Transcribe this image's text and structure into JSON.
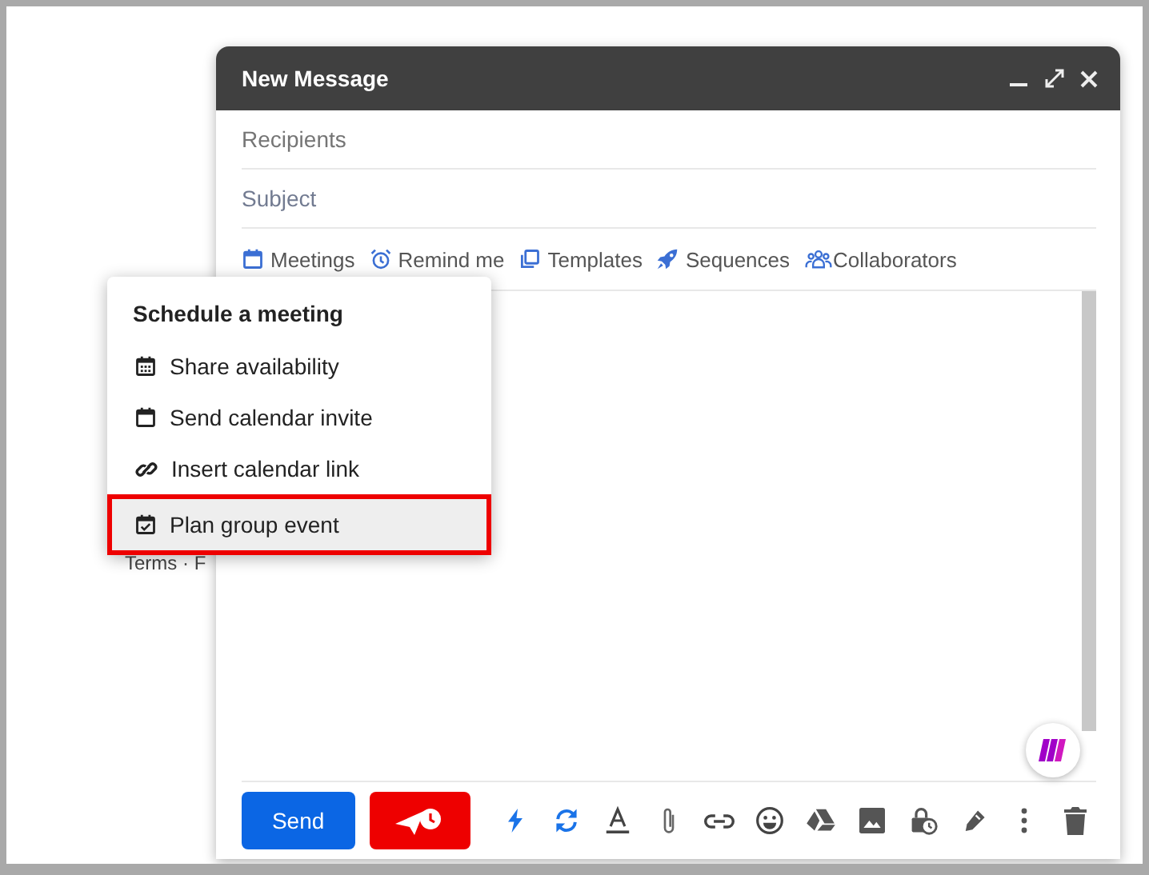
{
  "background": {
    "footer_text": "Terms · F"
  },
  "compose": {
    "title": "New Message",
    "fields": [
      {
        "kind": "recipients",
        "placeholder": "Recipients"
      },
      {
        "kind": "subject",
        "placeholder": "Subject"
      }
    ],
    "toolbar": [
      {
        "kind": "calendar",
        "label": "Meetings"
      },
      {
        "kind": "alarm",
        "label": "Remind me"
      },
      {
        "kind": "copy",
        "label": "Templates"
      },
      {
        "kind": "rocket",
        "label": "Sequences"
      },
      {
        "kind": "people",
        "label": "Collaborators"
      }
    ],
    "send_button": "Send"
  },
  "menu": {
    "title": "Schedule a meeting",
    "items": [
      {
        "kind": "grid-calendar",
        "label": "Share availability",
        "selected": false
      },
      {
        "kind": "calendar",
        "label": "Send calendar invite",
        "selected": false
      },
      {
        "kind": "link",
        "label": "Insert calendar link",
        "selected": false
      },
      {
        "kind": "check-calendar",
        "label": "Plan group event",
        "selected": true
      }
    ]
  }
}
